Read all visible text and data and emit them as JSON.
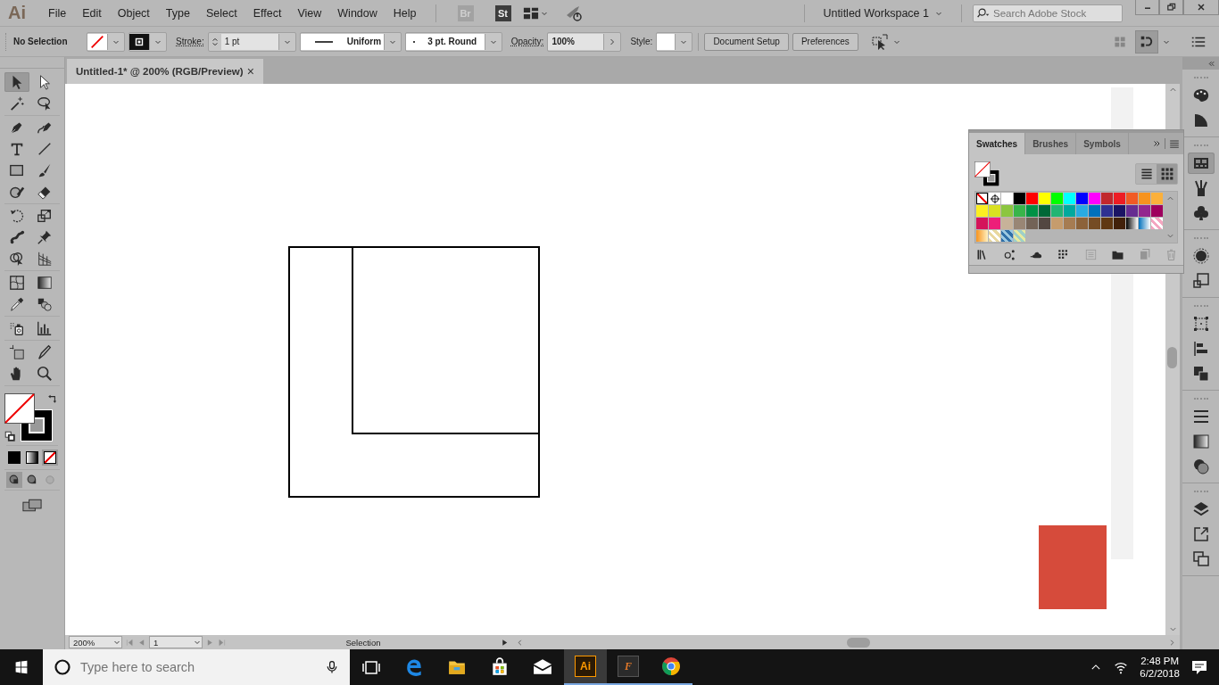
{
  "menu_bar": {
    "logo": "Ai",
    "menus": [
      "File",
      "Edit",
      "Object",
      "Type",
      "Select",
      "Effect",
      "View",
      "Window",
      "Help"
    ],
    "bridge": {
      "label": "Br",
      "disabled": true
    },
    "stock": {
      "label": "St",
      "disabled": false
    },
    "workspace": "Untitled Workspace 1",
    "search": {
      "placeholder": "Search Adobe Stock"
    }
  },
  "control_bar": {
    "selection": "No Selection",
    "stroke_label": "Stroke:",
    "stroke_weight": "1 pt",
    "profile": "Uniform",
    "brush": "3 pt. Round",
    "opacity_label": "Opacity:",
    "opacity": "100%",
    "style_label": "Style:",
    "buttons": [
      "Document Setup",
      "Preferences"
    ],
    "right_tools": [
      {
        "kind": "arrange",
        "selected": false,
        "disabled": true
      },
      {
        "kind": "snap",
        "selected": true,
        "disabled": false
      }
    ]
  },
  "document_tab": {
    "title": "Untitled-1* @ 200% (RGB/Preview)",
    "close": "×"
  },
  "tools": [
    {
      "items": [
        {
          "kind": "selection",
          "selected": true
        },
        {
          "kind": "direct-select",
          "selected": false
        },
        {
          "kind": "magic-wand",
          "selected": false
        },
        {
          "kind": "lasso",
          "selected": false
        }
      ]
    },
    {
      "items": [
        {
          "kind": "pen",
          "selected": false
        },
        {
          "kind": "curvature",
          "selected": false
        },
        {
          "kind": "type",
          "selected": false
        },
        {
          "kind": "line",
          "selected": false
        },
        {
          "kind": "rectangle",
          "selected": false
        },
        {
          "kind": "paintbrush",
          "selected": false
        },
        {
          "kind": "shaper",
          "selected": false
        },
        {
          "kind": "eraser",
          "selected": false
        }
      ]
    },
    {
      "items": [
        {
          "kind": "rotate",
          "selected": false
        },
        {
          "kind": "scale",
          "selected": false
        },
        {
          "kind": "puppet",
          "selected": false
        },
        {
          "kind": "pin",
          "selected": false
        },
        {
          "kind": "shape-builder",
          "selected": false
        },
        {
          "kind": "perspective",
          "selected": false
        }
      ]
    },
    {
      "items": [
        {
          "kind": "mesh",
          "selected": false
        },
        {
          "kind": "gradient",
          "selected": false
        },
        {
          "kind": "eyedropper",
          "selected": false
        },
        {
          "kind": "blend",
          "selected": false
        }
      ]
    },
    {
      "items": [
        {
          "kind": "sprayer",
          "selected": false
        },
        {
          "kind": "graph",
          "selected": false
        }
      ]
    },
    {
      "items": [
        {
          "kind": "artboard",
          "selected": false
        },
        {
          "kind": "slice",
          "selected": false
        },
        {
          "kind": "hand",
          "selected": false
        },
        {
          "kind": "zoom",
          "selected": false
        }
      ]
    }
  ],
  "color_modes": [
    {
      "kind": "color",
      "selected": false
    },
    {
      "kind": "gradient",
      "selected": false
    },
    {
      "kind": "none",
      "selected": true
    }
  ],
  "draw_modes": [
    {
      "kind": "normal",
      "selected": true,
      "disabled": false
    },
    {
      "kind": "behind",
      "selected": false,
      "disabled": false
    },
    {
      "kind": "inside",
      "selected": false,
      "disabled": true
    }
  ],
  "swatches_panel": {
    "tabs": [
      {
        "label": "Swatches",
        "selected": true
      },
      {
        "label": "Brushes",
        "selected": false
      },
      {
        "label": "Symbols",
        "selected": false
      }
    ],
    "views": [
      {
        "kind": "list",
        "selected": false
      },
      {
        "kind": "grid",
        "selected": true
      }
    ],
    "swatches": [
      {
        "kind": "none"
      },
      {
        "kind": "registration"
      },
      {
        "kind": "color",
        "color": "#ffffff"
      },
      {
        "kind": "color",
        "color": "#000000"
      },
      {
        "kind": "color",
        "color": "#ff0000"
      },
      {
        "kind": "color",
        "color": "#ffff00"
      },
      {
        "kind": "color",
        "color": "#00ff00"
      },
      {
        "kind": "color",
        "color": "#00ffff"
      },
      {
        "kind": "color",
        "color": "#0000ff"
      },
      {
        "kind": "color",
        "color": "#ff00ff"
      },
      {
        "kind": "color",
        "color": "#c1272d"
      },
      {
        "kind": "color",
        "color": "#ed1c24"
      },
      {
        "kind": "color",
        "color": "#f15a24"
      },
      {
        "kind": "color",
        "color": "#f7931e"
      },
      {
        "kind": "color",
        "color": "#fbb03b"
      },
      {
        "kind": "color",
        "color": "#fcee21"
      },
      {
        "kind": "color",
        "color": "#d9e021"
      },
      {
        "kind": "color",
        "color": "#8cc63f"
      },
      {
        "kind": "color",
        "color": "#39b54a"
      },
      {
        "kind": "color",
        "color": "#009245"
      },
      {
        "kind": "color",
        "color": "#006837"
      },
      {
        "kind": "color",
        "color": "#22b573"
      },
      {
        "kind": "color",
        "color": "#00a99d"
      },
      {
        "kind": "color",
        "color": "#29abe2"
      },
      {
        "kind": "color",
        "color": "#0071bc"
      },
      {
        "kind": "color",
        "color": "#2e3192"
      },
      {
        "kind": "color",
        "color": "#1b1464"
      },
      {
        "kind": "color",
        "color": "#662d91"
      },
      {
        "kind": "color",
        "color": "#93278f"
      },
      {
        "kind": "color",
        "color": "#9e005d"
      },
      {
        "kind": "color",
        "color": "#d4145a"
      },
      {
        "kind": "color",
        "color": "#ed1e79"
      },
      {
        "kind": "color",
        "color": "#c7b299"
      },
      {
        "kind": "color",
        "color": "#998675"
      },
      {
        "kind": "color",
        "color": "#736357"
      },
      {
        "kind": "color",
        "color": "#534741"
      },
      {
        "kind": "color",
        "color": "#c69c6d"
      },
      {
        "kind": "color",
        "color": "#a67c52"
      },
      {
        "kind": "color",
        "color": "#8c6239"
      },
      {
        "kind": "color",
        "color": "#754c24"
      },
      {
        "kind": "color",
        "color": "#603813"
      },
      {
        "kind": "color",
        "color": "#42210b"
      },
      {
        "kind": "gradient"
      },
      {
        "kind": "gradient"
      },
      {
        "kind": "pattern"
      },
      {
        "kind": "gradient"
      },
      {
        "kind": "pattern"
      },
      {
        "kind": "pattern"
      },
      {
        "kind": "pattern"
      }
    ],
    "footer_tools": [
      {
        "kind": "library",
        "disabled": false
      },
      {
        "kind": "show-kinds",
        "disabled": false
      },
      {
        "kind": "cloud",
        "disabled": false
      },
      {
        "kind": "swatch-groups",
        "disabled": false
      },
      {
        "kind": "options",
        "disabled": true
      },
      {
        "kind": "new-group",
        "disabled": false
      },
      {
        "kind": "new-swatch",
        "disabled": true
      },
      {
        "kind": "delete",
        "disabled": true
      }
    ]
  },
  "dock": [
    {
      "panels": [
        {
          "kind": "color",
          "selected": false
        },
        {
          "kind": "color-guide",
          "selected": false
        }
      ]
    },
    {
      "panels": [
        {
          "kind": "swatches",
          "selected": true
        },
        {
          "kind": "brushes",
          "selected": false
        },
        {
          "kind": "symbols",
          "selected": false
        }
      ]
    },
    {
      "panels": [
        {
          "kind": "appearance",
          "selected": false
        },
        {
          "kind": "graphic-styles",
          "selected": false
        }
      ]
    },
    {
      "panels": [
        {
          "kind": "transform",
          "selected": false
        },
        {
          "kind": "align",
          "selected": false
        },
        {
          "kind": "pathfinder",
          "selected": false
        }
      ]
    },
    {
      "panels": [
        {
          "kind": "stroke",
          "selected": false
        },
        {
          "kind": "gradient",
          "selected": false
        },
        {
          "kind": "transparency",
          "selected": false
        }
      ]
    },
    {
      "panels": [
        {
          "kind": "layers",
          "selected": false
        },
        {
          "kind": "export",
          "selected": false
        },
        {
          "kind": "artboards",
          "selected": false
        }
      ]
    }
  ],
  "status_bar": {
    "zoom": "200%",
    "artboard": "1",
    "status": "Selection"
  },
  "taskbar": {
    "search": {
      "placeholder": "Type here to search"
    },
    "apps": [
      {
        "kind": "task-view",
        "open": false,
        "selected": false
      },
      {
        "kind": "edge",
        "open": false,
        "selected": false
      },
      {
        "kind": "explorer",
        "open": false,
        "selected": false
      },
      {
        "kind": "store",
        "open": false,
        "selected": false
      },
      {
        "kind": "mail",
        "open": false,
        "selected": false
      },
      {
        "kind": "illustrator",
        "label": "Ai",
        "open": true,
        "selected": true
      },
      {
        "kind": "letter-app",
        "label": "F",
        "open": true,
        "selected": false
      },
      {
        "kind": "chrome",
        "open": true,
        "selected": false
      }
    ],
    "time": "2:48 PM",
    "date": "6/2/2018"
  }
}
